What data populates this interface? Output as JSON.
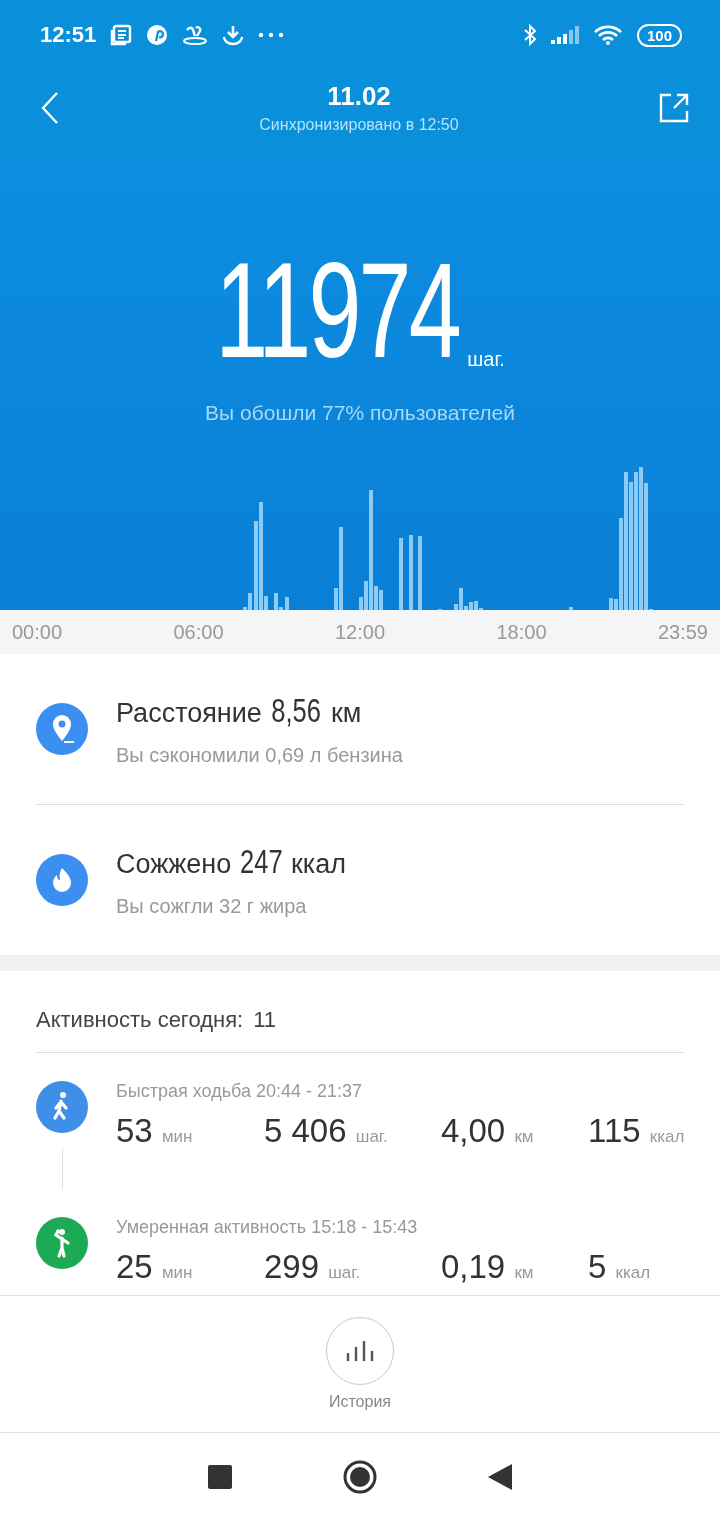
{
  "status_bar": {
    "time": "12:51",
    "battery": "100"
  },
  "header": {
    "title": "11.02",
    "subtitle": "Синхронизировано в 12:50"
  },
  "steps": {
    "value": "11974",
    "unit": "шаг.",
    "comparison": "Вы обошли 77% пользователей"
  },
  "chart_axis": [
    "00:00",
    "06:00",
    "12:00",
    "18:00",
    "23:59"
  ],
  "summary": [
    {
      "kind": "distance",
      "label": "Расстояние",
      "value": "8,56",
      "unit": "км",
      "note": "Вы сэкономили 0,69 л бензина"
    },
    {
      "kind": "calories",
      "label": "Сожжено",
      "value": "247",
      "unit": "ккал",
      "note": "Вы сожгли 32 г жира"
    }
  ],
  "activity": {
    "label": "Активность сегодня:",
    "count": "11",
    "items": [
      {
        "kind": "walk",
        "color": "#3f8fe8",
        "title": "Быстрая ходьба 20:44 - 21:37",
        "stats": [
          {
            "value": "53",
            "unit": "мин"
          },
          {
            "value": "5 406",
            "unit": "шаг."
          },
          {
            "value": "4,00",
            "unit": "км"
          },
          {
            "value": "115",
            "unit": "ккал"
          }
        ]
      },
      {
        "kind": "moderate",
        "color": "#1daa55",
        "title": "Умеренная активность 15:18 - 15:43",
        "stats": [
          {
            "value": "25",
            "unit": "мин"
          },
          {
            "value": "299",
            "unit": "шаг."
          },
          {
            "value": "0,19",
            "unit": "км"
          },
          {
            "value": "5",
            "unit": "ккал"
          }
        ]
      }
    ]
  },
  "history_button": {
    "label": "История"
  }
}
